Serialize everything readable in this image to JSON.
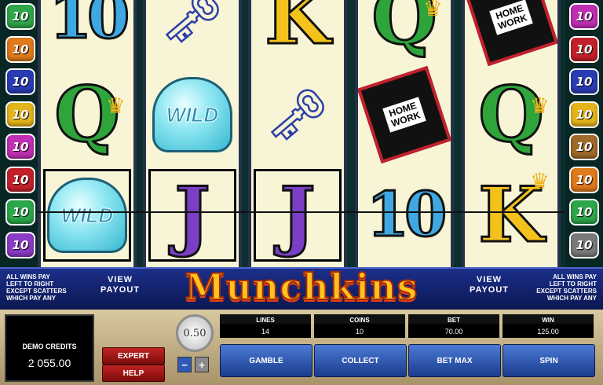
{
  "line_numbers": {
    "left": [
      "10",
      "10",
      "10",
      "10",
      "10",
      "10",
      "10",
      "10"
    ],
    "left_colors": [
      "#2ea64a",
      "#e07a1a",
      "#2b3bb4",
      "#e3b51b",
      "#c02fb3",
      "#c4202b",
      "#2aa84a",
      "#8b3bc6"
    ],
    "right": [
      "10",
      "10",
      "10",
      "10",
      "10",
      "10",
      "10",
      "10"
    ],
    "right_colors": [
      "#c02fb3",
      "#c4202b",
      "#2b3bb4",
      "#e3b51b",
      "#a06a2a",
      "#e07a1a",
      "#2ea64a",
      "#7a7a7a"
    ]
  },
  "reels": [
    [
      {
        "symbol": "10"
      },
      {
        "symbol": "Q"
      },
      {
        "symbol": "WILD",
        "win": true
      }
    ],
    [
      {
        "symbol": "keys"
      },
      {
        "symbol": "WILD"
      },
      {
        "symbol": "J",
        "win": true
      }
    ],
    [
      {
        "symbol": "K"
      },
      {
        "symbol": "keys"
      },
      {
        "symbol": "J",
        "win": true
      }
    ],
    [
      {
        "symbol": "Q"
      },
      {
        "symbol": "book"
      },
      {
        "symbol": "10"
      }
    ],
    [
      {
        "symbol": "book"
      },
      {
        "symbol": "Q"
      },
      {
        "symbol": "K"
      }
    ]
  ],
  "symbol_text": {
    "wild": "WILD",
    "book": "HOME\nWORK"
  },
  "banner": {
    "rules_text": "ALL WINS PAY\nLEFT TO RIGHT\nEXCEPT SCATTERS\nWHICH PAY ANY",
    "view_payout": "VIEW\nPAYOUT",
    "title": "Munchkins"
  },
  "console": {
    "credits_label": "DEMO CREDITS",
    "credits_value": "2 055.00",
    "expert_label": "EXPERT",
    "help_label": "HELP",
    "coin_value": "0.50",
    "minus": "−",
    "plus": "+",
    "stats": [
      {
        "label": "LINES",
        "value": "14"
      },
      {
        "label": "COINS",
        "value": "10"
      },
      {
        "label": "BET",
        "value": "70.00"
      },
      {
        "label": "WIN",
        "value": "125.00"
      }
    ],
    "buttons": [
      "GAMBLE",
      "COLLECT",
      "BET MAX",
      "SPIN"
    ]
  },
  "colors": {
    "reel_bg": "#f7f5d6",
    "banner_blue": "#1c2f8a",
    "title_yellow": "#ffc21f",
    "button_blue": "#2e59b8",
    "button_red": "#c12323"
  }
}
